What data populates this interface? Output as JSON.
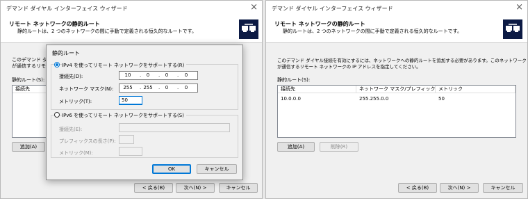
{
  "left_window": {
    "title": "デマンド ダイヤル インターフェイス ウィザード",
    "close": "×",
    "header_title": "リモート ネットワークの静的ルート",
    "header_sub": "静的ルートは、2 つのネットワークの間に手動で定義される恒久的なルートです。",
    "body_line1": "このデマンド ダ",
    "body_line2": "が通信するリモー",
    "list_label": "静的ルート(S):",
    "col_dest": "接続先",
    "add_button": "追加(A)",
    "back_button": "< 戻る(B)",
    "next_button": "次へ(N) >",
    "cancel_button": "キャンセル"
  },
  "dialog": {
    "title": "静的ルート",
    "ipv4_radio": "IPv4 を使ってリモート ネットワークをサポートする(R)",
    "dest_label": "接続先(D):",
    "dest_value": [
      "10",
      "0",
      "0",
      "0"
    ],
    "mask_label": "ネットワーク マスク(N):",
    "mask_value": [
      "255",
      "255",
      "0",
      "0"
    ],
    "metric_label": "メトリック(T):",
    "metric_value": "50",
    "ipv6_radio": "IPv6 を使ってリモート ネットワークをサポートする(S)",
    "ipv6_dest_label": "接続先(E):",
    "prefix_label": "プレフィックスの長さ(P):",
    "ipv6_metric_label": "メトリック(M):",
    "ok_button": "OK",
    "cancel_button": "キャンセル"
  },
  "right_window": {
    "title": "デマンド ダイヤル インターフェイス ウィザード",
    "close": "×",
    "header_title": "リモート ネットワークの静的ルート",
    "header_sub": "静的ルートは、2 つのネットワークの間に手動で定義される恒久的なルートです。",
    "body_line1": "このデマンド ダイヤル接続を有効にするには、ネットワークへの静的ルートを追加する必要があります。このネットワーク",
    "body_line2": "が通信するリモート ネットワークの IP アドレスを指定してください。",
    "list_label": "静的ルート(S):",
    "columns": [
      "接続先",
      "ネットワーク マスク/プレフィックス...",
      "メトリック"
    ],
    "rows": [
      {
        "dest": "10.0.0.0",
        "mask": "255.255.0.0",
        "metric": "50"
      }
    ],
    "add_button": "追加(A)",
    "delete_button": "削除(R)",
    "back_button": "< 戻る(B)",
    "next_button": "次へ(N) >",
    "cancel_button": "キャンセル"
  },
  "colors": {
    "accent": "#0078d7",
    "logo_bg": "#0c1a44"
  }
}
